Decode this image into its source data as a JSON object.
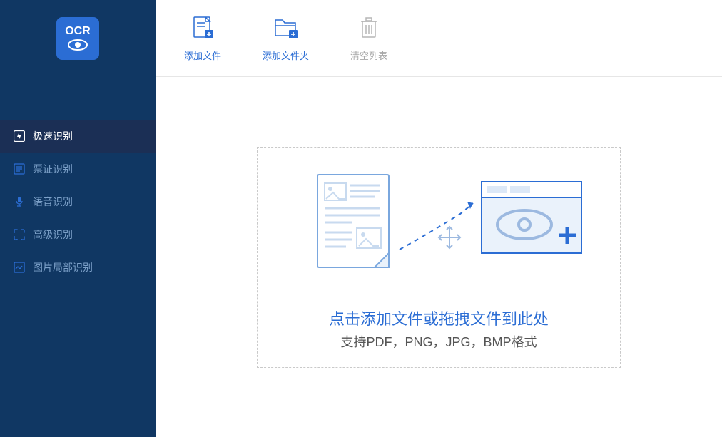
{
  "logo": {
    "text": "OCR"
  },
  "sidebar": {
    "items": [
      {
        "label": "极速识别"
      },
      {
        "label": "票证识别"
      },
      {
        "label": "语音识别"
      },
      {
        "label": "高级识别"
      },
      {
        "label": "图片局部识别"
      }
    ]
  },
  "toolbar": {
    "add_file": "添加文件",
    "add_folder": "添加文件夹",
    "clear_list": "清空列表"
  },
  "dropzone": {
    "title": "点击添加文件或拖拽文件到此处",
    "subtitle": "支持PDF，PNG，JPG，BMP格式"
  }
}
